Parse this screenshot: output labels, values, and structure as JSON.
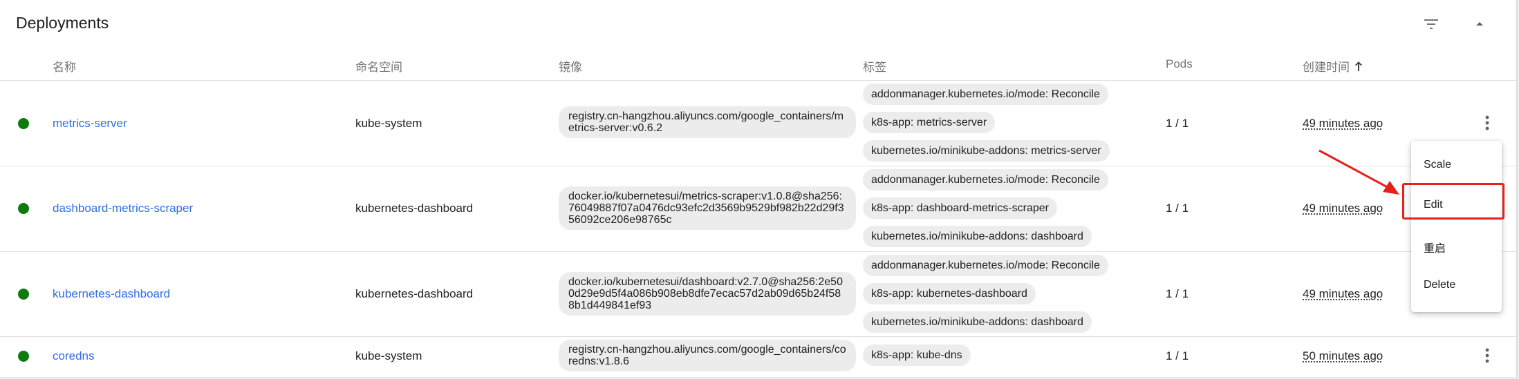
{
  "card": {
    "title": "Deployments"
  },
  "header_icons": {
    "filter": "filter-icon",
    "collapse": "chevron-up-icon"
  },
  "columns": {
    "name": "名称",
    "namespace": "命名空间",
    "image": "镜像",
    "labels": "标签",
    "pods": "Pods",
    "created": "创建时间"
  },
  "rows": [
    {
      "status": "running",
      "name": "metrics-server",
      "namespace": "kube-system",
      "image": "registry.cn-hangzhou.aliyuncs.com/google_containers/metrics-server:v0.6.2",
      "labels": [
        "addonmanager.kubernetes.io/mode: Reconcile",
        "k8s-app: metrics-server",
        "kubernetes.io/minikube-addons: metrics-server"
      ],
      "pods": "1 / 1",
      "created": "49 minutes ago"
    },
    {
      "status": "running",
      "name": "dashboard-metrics-scraper",
      "namespace": "kubernetes-dashboard",
      "image": "docker.io/kubernetesui/metrics-scraper:v1.0.8@sha256:76049887f07a0476dc93efc2d3569b9529bf982b22d29f356092ce206e98765c",
      "labels": [
        "addonmanager.kubernetes.io/mode: Reconcile",
        "k8s-app: dashboard-metrics-scraper",
        "kubernetes.io/minikube-addons: dashboard"
      ],
      "pods": "1 / 1",
      "created": "49 minutes ago"
    },
    {
      "status": "running",
      "name": "kubernetes-dashboard",
      "namespace": "kubernetes-dashboard",
      "image": "docker.io/kubernetesui/dashboard:v2.7.0@sha256:2e500d29e9d5f4a086b908eb8dfe7ecac57d2ab09d65b24f588b1d449841ef93",
      "labels": [
        "addonmanager.kubernetes.io/mode: Reconcile",
        "k8s-app: kubernetes-dashboard",
        "kubernetes.io/minikube-addons: dashboard"
      ],
      "pods": "1 / 1",
      "created": "49 minutes ago"
    },
    {
      "status": "running",
      "name": "coredns",
      "namespace": "kube-system",
      "image": "registry.cn-hangzhou.aliyuncs.com/google_containers/coredns:v1.8.6",
      "labels": [
        "k8s-app: kube-dns"
      ],
      "pods": "1 / 1",
      "created": "50 minutes ago"
    }
  ],
  "context_menu": {
    "items": [
      "Scale",
      "Edit",
      "重启",
      "Delete"
    ],
    "highlighted": "Edit"
  },
  "colors": {
    "link": "#326de6",
    "status_ok": "#0f7b0f",
    "annotation": "#e8201c",
    "chip_bg": "#ececec"
  }
}
